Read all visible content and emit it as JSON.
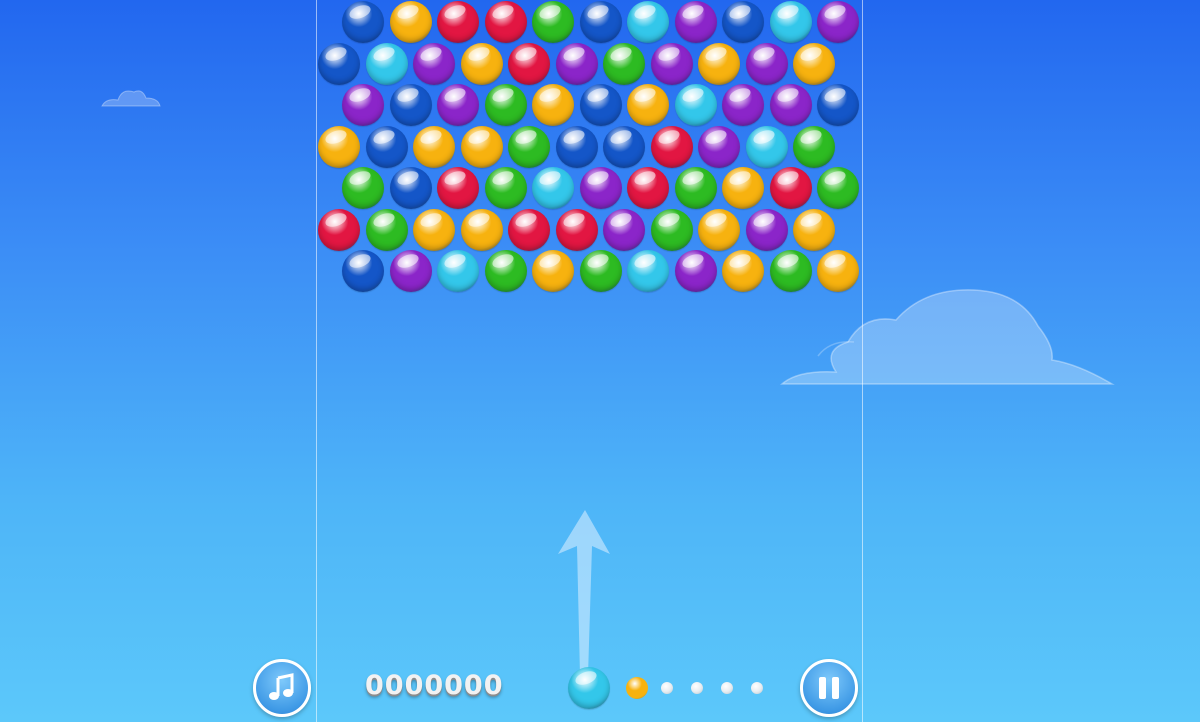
{
  "hud": {
    "score": "0000000",
    "music_icon": "music-note-icon",
    "pause_icon": "pause-icon"
  },
  "colors": {
    "blue": "#1456c8",
    "yellow": "#f7b20f",
    "red": "#e21642",
    "green": "#2dbb22",
    "cyan": "#33c7ea",
    "purple": "#8b25c9"
  },
  "board": {
    "rows": [
      [
        "blue",
        "yellow",
        "red",
        "red",
        "green",
        "blue",
        "cyan",
        "purple",
        "blue",
        "cyan",
        "purple"
      ],
      [
        "blue",
        "cyan",
        "purple",
        "yellow",
        "red",
        "purple",
        "green",
        "purple",
        "yellow",
        "purple",
        "yellow"
      ],
      [
        "purple",
        "blue",
        "purple",
        "green",
        "yellow",
        "blue",
        "yellow",
        "cyan",
        "purple",
        "purple",
        "blue"
      ],
      [
        "yellow",
        "blue",
        "yellow",
        "yellow",
        "green",
        "blue",
        "blue",
        "red",
        "purple",
        "cyan",
        "green"
      ],
      [
        "green",
        "blue",
        "red",
        "green",
        "cyan",
        "purple",
        "red",
        "green",
        "yellow",
        "red",
        "green"
      ],
      [
        "red",
        "green",
        "yellow",
        "yellow",
        "red",
        "red",
        "purple",
        "green",
        "yellow",
        "purple",
        "yellow"
      ],
      [
        "blue",
        "purple",
        "cyan",
        "green",
        "yellow",
        "green",
        "cyan",
        "purple",
        "yellow",
        "green",
        "yellow"
      ]
    ]
  },
  "shooter": {
    "current": "cyan",
    "next_queue": [
      "yellow",
      "white",
      "white",
      "white",
      "white"
    ]
  }
}
